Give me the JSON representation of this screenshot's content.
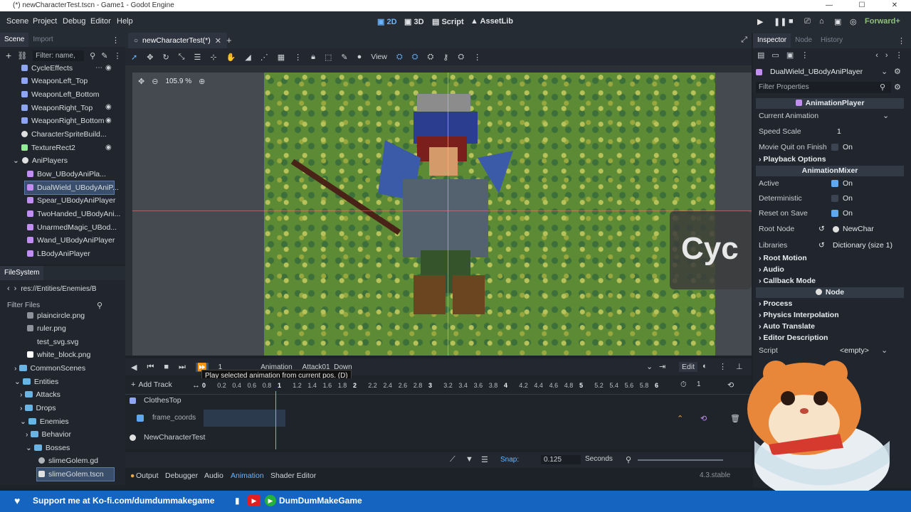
{
  "window": {
    "title": "(*) newCharacterTest.tscn - Game1 - Godot Engine"
  },
  "menu": {
    "items": [
      "Scene",
      "Project",
      "Debug",
      "Editor",
      "Help"
    ]
  },
  "workspaces": {
    "items": [
      "2D",
      "3D",
      "Script",
      "AssetLib"
    ],
    "active": "2D"
  },
  "renderer": "Forward+",
  "scene_dock": {
    "tabs": [
      "Scene",
      "Import"
    ],
    "filter_placeholder": "Filter: name,",
    "nodes": [
      {
        "label": "CycleEffects",
        "icon": "node2d-icon"
      },
      {
        "label": "WeaponLeft_Top",
        "icon": "node2d-icon"
      },
      {
        "label": "WeaponLeft_Bottom",
        "icon": "node2d-icon"
      },
      {
        "label": "WeaponRight_Top",
        "icon": "node2d-icon"
      },
      {
        "label": "WeaponRight_Bottom",
        "icon": "node2d-icon"
      },
      {
        "label": "CharacterSpriteBuild...",
        "icon": "node-icon"
      },
      {
        "label": "TextureRect2",
        "icon": "control-icon"
      },
      {
        "label": "AniPlayers",
        "icon": "node-icon"
      },
      {
        "label": "Bow_UBodyAniPla...",
        "icon": "animation-player-icon"
      },
      {
        "label": "DualWield_UBodyAniP...",
        "icon": "animation-player-icon",
        "selected": true
      },
      {
        "label": "Spear_UBodyAniPlayer",
        "icon": "animation-player-icon"
      },
      {
        "label": "TwoHanded_UBodyAni...",
        "icon": "animation-player-icon"
      },
      {
        "label": "UnarmedMagic_UBod...",
        "icon": "animation-player-icon"
      },
      {
        "label": "Wand_UBodyAniPlayer",
        "icon": "animation-player-icon"
      },
      {
        "label": "LBodyAniPlayer",
        "icon": "animation-player-icon"
      }
    ]
  },
  "filesystem": {
    "title": "FileSystem",
    "path": "res://Entities/Enemies/B",
    "filter_placeholder": "Filter Files",
    "items": [
      {
        "label": "plaincircle.png",
        "icon": "image-icon"
      },
      {
        "label": "ruler.png",
        "icon": "image-icon"
      },
      {
        "label": "test_svg.svg",
        "icon": "image-icon"
      },
      {
        "label": "white_block.png",
        "icon": "image-icon"
      },
      {
        "label": "CommonScenes",
        "icon": "folder-icon"
      },
      {
        "label": "Entities",
        "icon": "folder-icon"
      },
      {
        "label": "Attacks",
        "icon": "folder-icon"
      },
      {
        "label": "Drops",
        "icon": "folder-icon"
      },
      {
        "label": "Enemies",
        "icon": "folder-icon"
      },
      {
        "label": "Behavior",
        "icon": "folder-icon"
      },
      {
        "label": "Bosses",
        "icon": "folder-icon"
      },
      {
        "label": "slimeGolem.gd",
        "icon": "script-icon"
      },
      {
        "label": "slimeGolem.tscn",
        "icon": "scene-icon",
        "selected": true
      }
    ]
  },
  "editor_tabs": {
    "items": [
      "newCharacterTest(*)"
    ]
  },
  "viewport": {
    "zoom": "105.9 %",
    "view_label": "View",
    "overlay_text": "Cyc"
  },
  "animation": {
    "frame": "1",
    "label": "Animation",
    "current": "Attack01_Down",
    "edit_label": "Edit",
    "tooltip": "Play selected animation from current pos. (D)",
    "add_track": "Add Track",
    "length": "1",
    "time_ticks": [
      "0",
      "0.2",
      "0.4",
      "0.6",
      "0.8",
      "1",
      "1.2",
      "1.4",
      "1.6",
      "1.8",
      "2",
      "2.2",
      "2.4",
      "2.6",
      "2.8",
      "3",
      "3.2",
      "3.4",
      "3.6",
      "3.8",
      "4",
      "4.2",
      "4.4",
      "4.6",
      "4.8",
      "5",
      "5.2",
      "5.4",
      "5.6",
      "5.8",
      "6"
    ],
    "tracks": [
      {
        "group": "ClothesTop",
        "property": "frame_coords"
      },
      {
        "group": "NewCharacterTest",
        "property": ""
      }
    ],
    "snap_label": "Snap:",
    "snap_value": "0.125",
    "units": "Seconds"
  },
  "bottom_panel": {
    "tabs": [
      "Output",
      "Debugger",
      "Audio",
      "Animation",
      "Shader Editor"
    ],
    "active": "Animation",
    "version": "4.3.stable"
  },
  "inspector": {
    "tabs": [
      "Inspector",
      "Node",
      "History"
    ],
    "node_name": "DualWield_UBodyAniPlayer",
    "filter_placeholder": "Filter Properties",
    "class_header": "AnimationPlayer",
    "mixer_header": "AnimationMixer",
    "node_header": "Node",
    "properties": {
      "current_animation": "Current Animation",
      "speed_scale": "Speed Scale",
      "speed_scale_value": "1",
      "movie_quit": "Movie Quit on Finish",
      "playback_options": "Playback Options",
      "active": "Active",
      "deterministic": "Deterministic",
      "reset_on_save": "Reset on Save",
      "root_node": "Root Node",
      "root_node_value": "NewChar",
      "libraries": "Libraries",
      "libraries_value": "Dictionary (size 1)",
      "root_motion": "Root Motion",
      "audio": "Audio",
      "callback_mode": "Callback Mode",
      "process": "Process",
      "physics_interpolation": "Physics Interpolation",
      "auto_translate": "Auto Translate",
      "editor_description": "Editor Description",
      "script": "Script",
      "script_value": "<empty>",
      "on": "On"
    }
  },
  "banner": {
    "left": "Support me at Ko-fi.com/dumdummakegame",
    "right": "DumDumMakeGame"
  },
  "colors": {
    "accent": "#6ab4ff",
    "banner": "#1565c0",
    "canvas": "#4a7a2a"
  }
}
